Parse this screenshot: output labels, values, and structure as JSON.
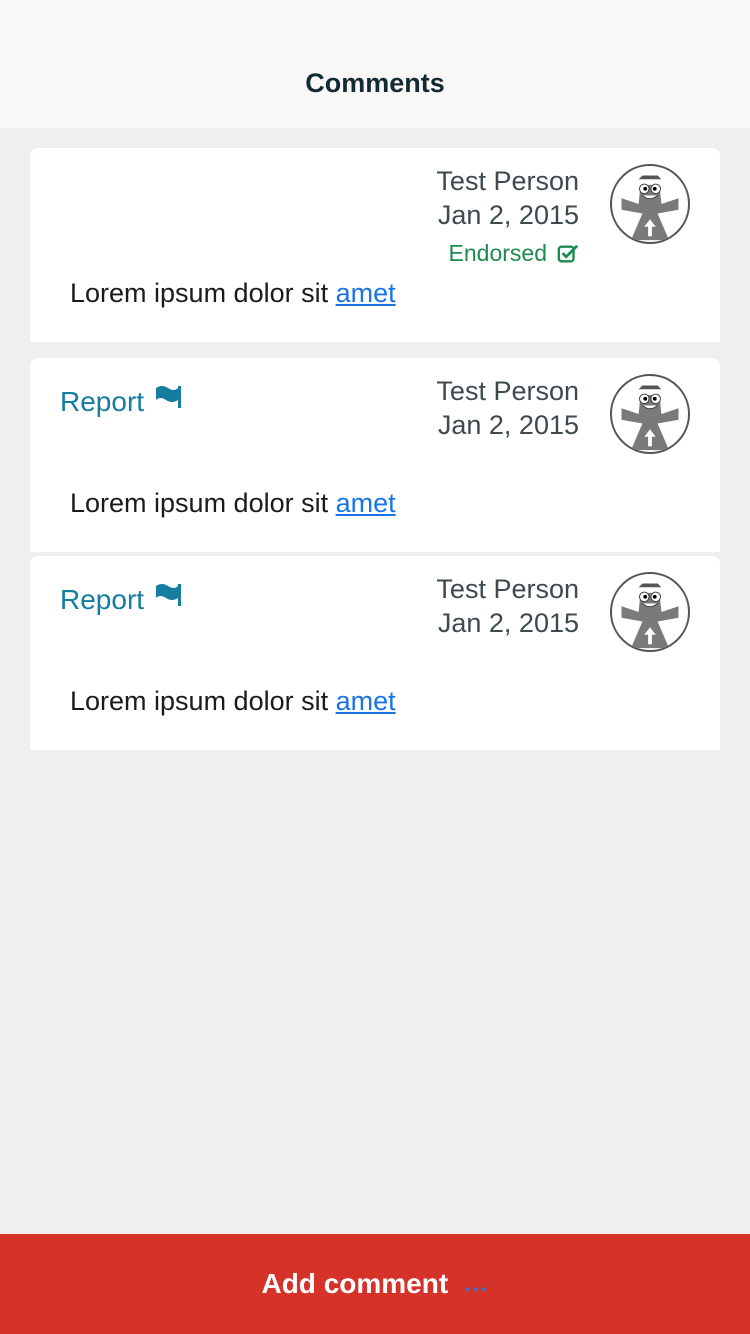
{
  "header": {
    "title": "Comments"
  },
  "comments": [
    {
      "author": "Test Person",
      "date": "Jan 2, 2015",
      "endorsed_label": "Endorsed",
      "text": "Lorem ipsum dolor sit ",
      "link": "amet"
    },
    {
      "report_label": "Report",
      "author": "Test Person",
      "date": "Jan 2, 2015",
      "text": "Lorem ipsum dolor sit ",
      "link": "amet"
    },
    {
      "report_label": "Report",
      "author": "Test Person",
      "date": "Jan 2, 2015",
      "text": "Lorem ipsum dolor sit ",
      "link": "amet"
    }
  ],
  "footer": {
    "add_comment_label": "Add comment",
    "ellipsis": "..."
  },
  "colors": {
    "header_bg": "#f9f8f6",
    "page_bg": "#f0efed",
    "report": "#157ea0",
    "endorsed": "#1d8a4f",
    "link": "#1a74e8",
    "button": "#d5332a"
  },
  "icons": {
    "endorsed": "checkbox-checked-icon",
    "report": "flag-icon",
    "avatar": "mascot-avatar"
  }
}
